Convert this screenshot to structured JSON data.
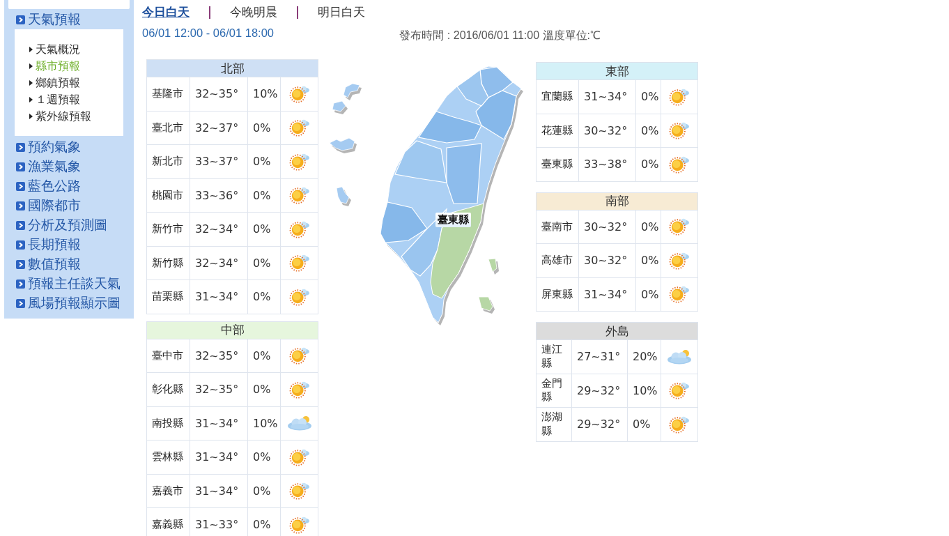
{
  "sidebar": {
    "items": [
      {
        "label": "天氣預報",
        "children": [
          {
            "label": "天氣概況",
            "selected": false
          },
          {
            "label": "縣市預報",
            "selected": true
          },
          {
            "label": "鄉鎮預報",
            "selected": false
          },
          {
            "label": "１週預報",
            "selected": false
          },
          {
            "label": "紫外線預報",
            "selected": false
          }
        ]
      },
      {
        "label": "預約氣象"
      },
      {
        "label": "漁業氣象"
      },
      {
        "label": "藍色公路"
      },
      {
        "label": "國際都市"
      },
      {
        "label": "分析及預測圖"
      },
      {
        "label": "長期預報"
      },
      {
        "label": "數值預報"
      },
      {
        "label": "預報主任談天氣"
      },
      {
        "label": "風場預報顯示圖"
      }
    ]
  },
  "tabs": [
    {
      "label": "今日白天",
      "selected": true
    },
    {
      "label": "今晚明晨",
      "selected": false
    },
    {
      "label": "明日白天",
      "selected": false
    }
  ],
  "period": "06/01 12:00 - 06/01 18:00",
  "issue_info": "發布時間 : 2016/06/01 11:00 溫度單位:℃",
  "forecast": {
    "left_regions": [
      {
        "name": "北部",
        "color": "#cfe0f5",
        "rows": [
          {
            "county": "基隆市",
            "temp": "32~35°",
            "rain": "10%",
            "kind": "sunny"
          },
          {
            "county": "臺北市",
            "temp": "32~37°",
            "rain": "0%",
            "kind": "sunny"
          },
          {
            "county": "新北市",
            "temp": "33~37°",
            "rain": "0%",
            "kind": "sunny"
          },
          {
            "county": "桃園市",
            "temp": "33~36°",
            "rain": "0%",
            "kind": "sunny"
          },
          {
            "county": "新竹市",
            "temp": "32~34°",
            "rain": "0%",
            "kind": "sunny"
          },
          {
            "county": "新竹縣",
            "temp": "32~34°",
            "rain": "0%",
            "kind": "sunny"
          },
          {
            "county": "苗栗縣",
            "temp": "31~34°",
            "rain": "0%",
            "kind": "sunny"
          }
        ]
      },
      {
        "name": "中部",
        "color": "#e6f6dd",
        "rows": [
          {
            "county": "臺中市",
            "temp": "32~35°",
            "rain": "0%",
            "kind": "sunny"
          },
          {
            "county": "彰化縣",
            "temp": "32~35°",
            "rain": "0%",
            "kind": "sunny"
          },
          {
            "county": "南投縣",
            "temp": "31~34°",
            "rain": "10%",
            "kind": "cloudy"
          },
          {
            "county": "雲林縣",
            "temp": "31~34°",
            "rain": "0%",
            "kind": "sunny"
          },
          {
            "county": "嘉義市",
            "temp": "31~34°",
            "rain": "0%",
            "kind": "sunny"
          },
          {
            "county": "嘉義縣",
            "temp": "31~33°",
            "rain": "0%",
            "kind": "sunny"
          }
        ]
      }
    ],
    "map": {
      "label": "臺東縣"
    },
    "right_regions": [
      {
        "name": "東部",
        "color": "#d4f1f8",
        "rows": [
          {
            "county": "宜蘭縣",
            "temp": "31~34°",
            "rain": "0%",
            "kind": "sunny"
          },
          {
            "county": "花蓮縣",
            "temp": "30~32°",
            "rain": "0%",
            "kind": "sunny"
          },
          {
            "county": "臺東縣",
            "temp": "33~38°",
            "rain": "0%",
            "kind": "sunny"
          }
        ]
      },
      {
        "name": "南部",
        "color": "#f7ebd4",
        "rows": [
          {
            "county": "臺南市",
            "temp": "30~32°",
            "rain": "0%",
            "kind": "sunny"
          },
          {
            "county": "高雄市",
            "temp": "30~32°",
            "rain": "0%",
            "kind": "sunny"
          },
          {
            "county": "屏東縣",
            "temp": "31~34°",
            "rain": "0%",
            "kind": "sunny"
          }
        ]
      },
      {
        "name": "外島",
        "color": "#dcdcdc",
        "rows": [
          {
            "county": "連江縣",
            "temp": "27~31°",
            "rain": "20%",
            "kind": "cloudy"
          },
          {
            "county": "金門縣",
            "temp": "29~32°",
            "rain": "10%",
            "kind": "sunny"
          },
          {
            "county": "澎湖縣",
            "temp": "29~32°",
            "rain": "0%",
            "kind": "sunny"
          }
        ]
      }
    ]
  }
}
